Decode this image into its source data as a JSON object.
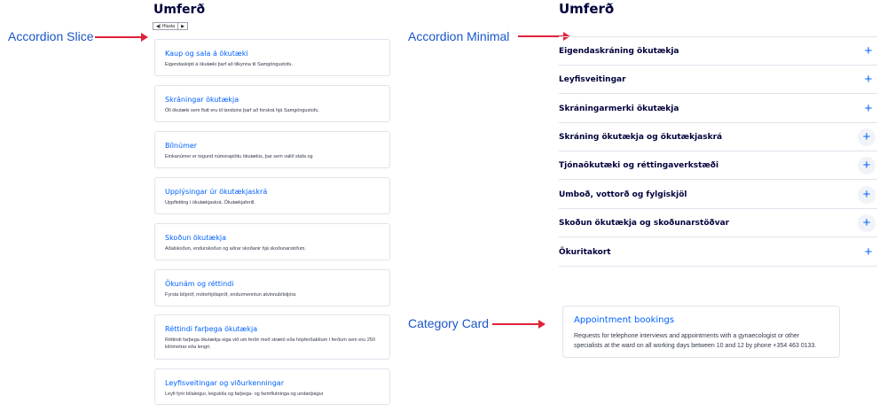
{
  "annotations": {
    "slice_label": "Accordion Slice",
    "minimal_label": "Accordion Minimal",
    "category_label": "Category Card",
    "arrow_color": "#e0233a"
  },
  "slice_panel": {
    "title": "Umferð",
    "lang_toggle": {
      "left": "◀) Hlusta",
      "right": "▶"
    },
    "cards": [
      {
        "title": "Kaup og sala á ökutæki",
        "desc": "Eigendaskipti á ökutæki þarf að tilkynna til Samgöngustofu."
      },
      {
        "title": "Skráningar ökutækja",
        "desc": "Öll ökutæki sem flutt eru til landsins þarf að forskrá hjá Samgöngustofu."
      },
      {
        "title": "Bílnúmer",
        "desc": "Einkanúmer er tegund númeraplötu ökutækis, þar sem valið stafa og"
      },
      {
        "title": "Upplýsingar úr ökutækjaskrá",
        "desc": "Uppfletting í ökutækjaskrá. Ökutækjaferill."
      },
      {
        "title": "Skoðun ökutækja",
        "desc": "Aðalskoðun, endurskoðun og aðrar skoðanir hjá skoðunarstofum."
      },
      {
        "title": "Ökunám og réttindi",
        "desc": "Fyrsta bílpróf, mótorhjólapróf, endurmenntun atvinnubílstjóra"
      },
      {
        "title": "Réttindi farþega ökutækja",
        "desc": "Réttindi farþega ökutækja eiga við um ferðir með strætó eða hópferðabílum í ferðum sem eru 250 kílómetrar eða lengri."
      },
      {
        "title": "Leyfisveitingar og viðurkenningar",
        "desc": "Leyfi fyrir bílaleigur, leigubíla og farþega- og farmflutninga og undanþágur"
      }
    ]
  },
  "minimal_panel": {
    "title": "Umferð",
    "items": [
      {
        "label": "Eigendaskráning ökutækja",
        "icon": "plus-icon"
      },
      {
        "label": "Leyfisveitingar",
        "icon": "plus-icon"
      },
      {
        "label": "Skráningarmerki ökutækja",
        "icon": "plus-icon"
      },
      {
        "label": "Skráning ökutækja og ökutækjaskrá",
        "icon": "plus-icon"
      },
      {
        "label": "Tjónaökutæki og réttingaverkstæði",
        "icon": "plus-icon"
      },
      {
        "label": "Umboð, vottorð og fylgiskjöl",
        "icon": "plus-icon"
      },
      {
        "label": "Skoðun ökutækja og skoðunarstöðvar",
        "icon": "plus-icon"
      },
      {
        "label": "Ökuritakort",
        "icon": "plus-icon"
      }
    ]
  },
  "category_card": {
    "title": "Appointment bookings",
    "desc": "Requests for telephone interviews and appointments with a gynaecologist or other specialists at the ward on all working days between 10 and 12 by phone +354 463 0133."
  },
  "colors": {
    "brand_blue": "#0061ff",
    "heading": "#00003c",
    "annotation_blue": "#1a56c9",
    "border": "#dfe3ec"
  }
}
